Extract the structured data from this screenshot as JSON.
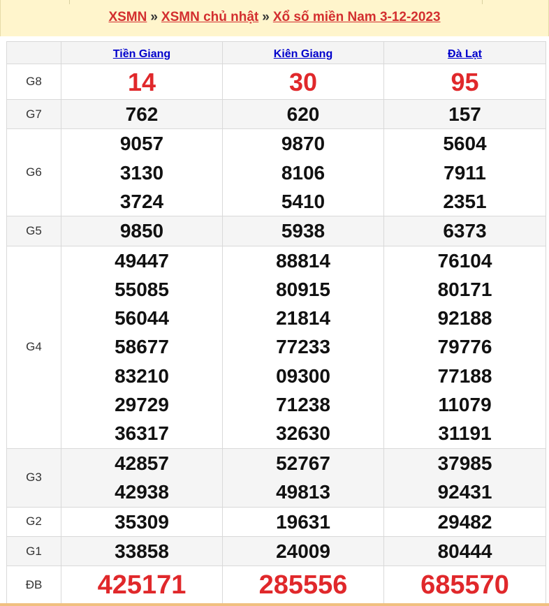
{
  "breadcrumb": {
    "link1": "XSMN",
    "sep1": "»",
    "link2": "XSMN chủ nhật",
    "sep2": "»",
    "link3": "Xổ số miền Nam 3-12-2023"
  },
  "columns": [
    "Tiền Giang",
    "Kiên Giang",
    "Đà Lạt"
  ],
  "prizes": [
    {
      "label": "G8",
      "values": [
        [
          "14"
        ],
        [
          "30"
        ],
        [
          "95"
        ]
      ]
    },
    {
      "label": "G7",
      "values": [
        [
          "762"
        ],
        [
          "620"
        ],
        [
          "157"
        ]
      ]
    },
    {
      "label": "G6",
      "values": [
        [
          "9057",
          "3130",
          "3724"
        ],
        [
          "9870",
          "8106",
          "5410"
        ],
        [
          "5604",
          "7911",
          "2351"
        ]
      ]
    },
    {
      "label": "G5",
      "values": [
        [
          "9850"
        ],
        [
          "5938"
        ],
        [
          "6373"
        ]
      ]
    },
    {
      "label": "G4",
      "values": [
        [
          "49447",
          "55085",
          "56044",
          "58677",
          "83210",
          "29729",
          "36317"
        ],
        [
          "88814",
          "80915",
          "21814",
          "77233",
          "09300",
          "71238",
          "32630"
        ],
        [
          "76104",
          "80171",
          "92188",
          "79776",
          "77188",
          "11079",
          "31191"
        ]
      ]
    },
    {
      "label": "G3",
      "values": [
        [
          "42857",
          "42938"
        ],
        [
          "52767",
          "49813"
        ],
        [
          "37985",
          "92431"
        ]
      ]
    },
    {
      "label": "G2",
      "values": [
        [
          "35309"
        ],
        [
          "19631"
        ],
        [
          "29482"
        ]
      ]
    },
    {
      "label": "G1",
      "values": [
        [
          "33858"
        ],
        [
          "24009"
        ],
        [
          "80444"
        ]
      ]
    },
    {
      "label": "ĐB",
      "values": [
        [
          "425171"
        ],
        [
          "285556"
        ],
        [
          "685570"
        ]
      ]
    }
  ],
  "colors": {
    "accent_red": "#e0282b",
    "link_blue": "#0000cc",
    "header_band": "#fff5cc"
  }
}
